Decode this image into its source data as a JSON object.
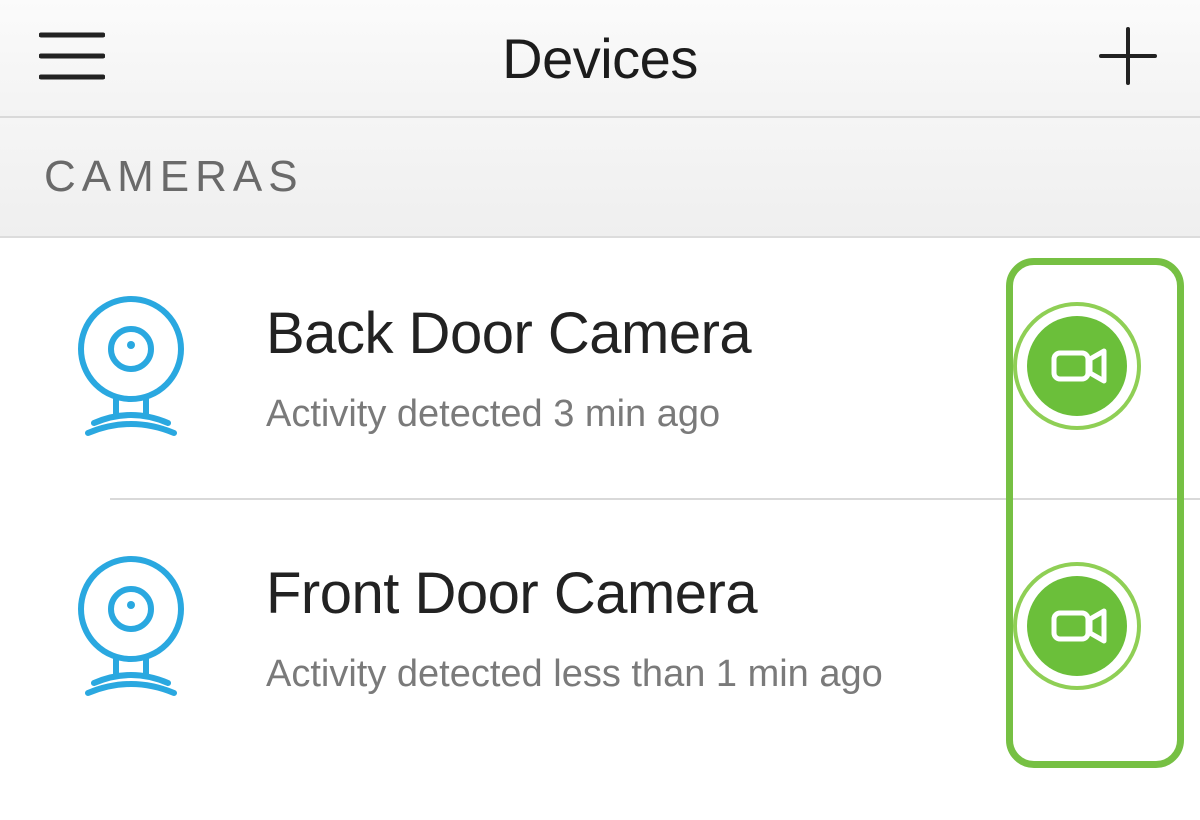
{
  "header": {
    "title": "Devices"
  },
  "section": {
    "label": "CAMERAS"
  },
  "devices": [
    {
      "name": "Back Door Camera",
      "status": "Activity detected 3 min ago"
    },
    {
      "name": "Front Door Camera",
      "status": "Activity detected less than 1 min ago"
    }
  ],
  "colors": {
    "accent_green": "#6bbf3a",
    "accent_green_ring": "#8fcf55",
    "camera_icon_blue": "#2aa8e0"
  }
}
